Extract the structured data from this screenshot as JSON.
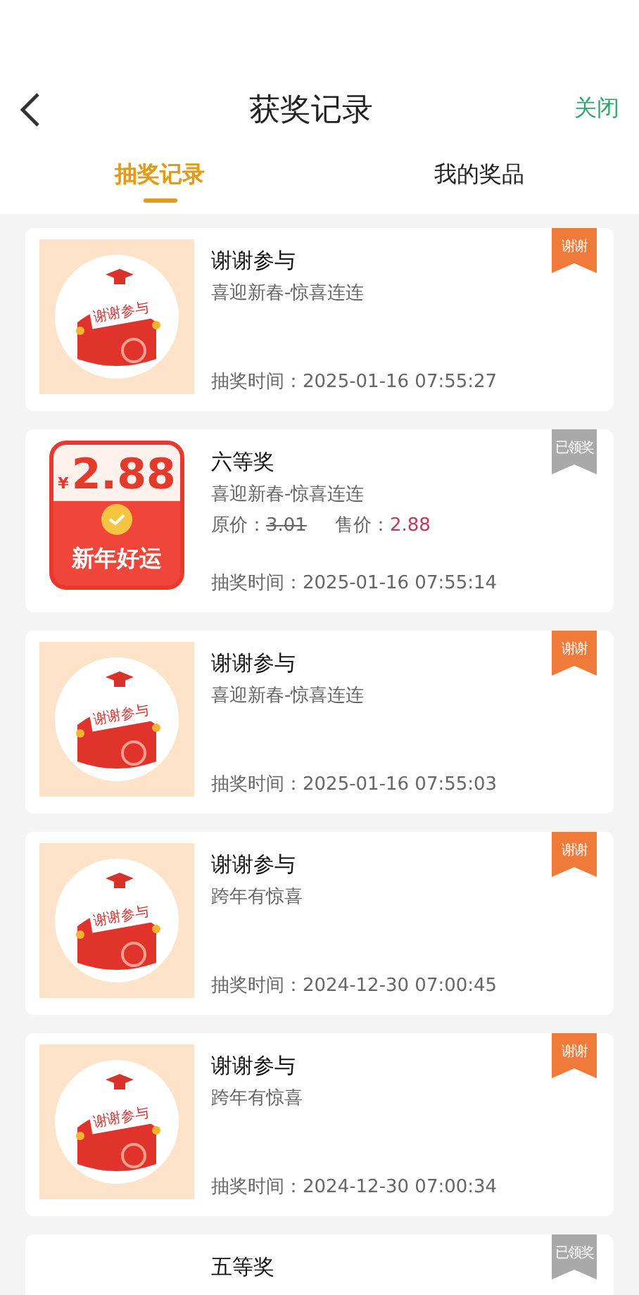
{
  "header": {
    "title": "获奖记录",
    "close": "关闭"
  },
  "tabs": [
    {
      "label": "抽奖记录",
      "selected": true
    },
    {
      "label": "我的奖品",
      "selected": false
    }
  ],
  "records": [
    {
      "kind": "thanks",
      "title": "谢谢参与",
      "campaign": "喜迎新春-惊喜连连",
      "image_label": "谢谢参与",
      "badge": {
        "kind": "thanks",
        "label": "谢谢"
      },
      "time": "抽奖时间：2025-01-16 07:55:27"
    },
    {
      "kind": "prize",
      "title": "六等奖",
      "campaign": "喜迎新春-惊喜连连",
      "image_currency": "¥",
      "image_amount": "2.88",
      "image_caption": "新年好运",
      "price": {
        "original_label": "原价：",
        "original": "3.01",
        "sale_label": "售价：",
        "sale": "2.88"
      },
      "badge": {
        "kind": "claimed",
        "label": "已领奖"
      },
      "time": "抽奖时间：2025-01-16 07:55:14"
    },
    {
      "kind": "thanks",
      "title": "谢谢参与",
      "campaign": "喜迎新春-惊喜连连",
      "image_label": "谢谢参与",
      "badge": {
        "kind": "thanks",
        "label": "谢谢"
      },
      "time": "抽奖时间：2025-01-16 07:55:03"
    },
    {
      "kind": "thanks",
      "title": "谢谢参与",
      "campaign": "跨年有惊喜",
      "image_label": "谢谢参与",
      "badge": {
        "kind": "thanks",
        "label": "谢谢"
      },
      "time": "抽奖时间：2024-12-30 07:00:45"
    },
    {
      "kind": "thanks",
      "title": "谢谢参与",
      "campaign": "跨年有惊喜",
      "image_label": "谢谢参与",
      "badge": {
        "kind": "thanks",
        "label": "谢谢"
      },
      "time": "抽奖时间：2024-12-30 07:00:34"
    },
    {
      "kind": "partial",
      "title": "五等奖",
      "badge": {
        "kind": "claimed",
        "label": "已领奖"
      }
    }
  ]
}
